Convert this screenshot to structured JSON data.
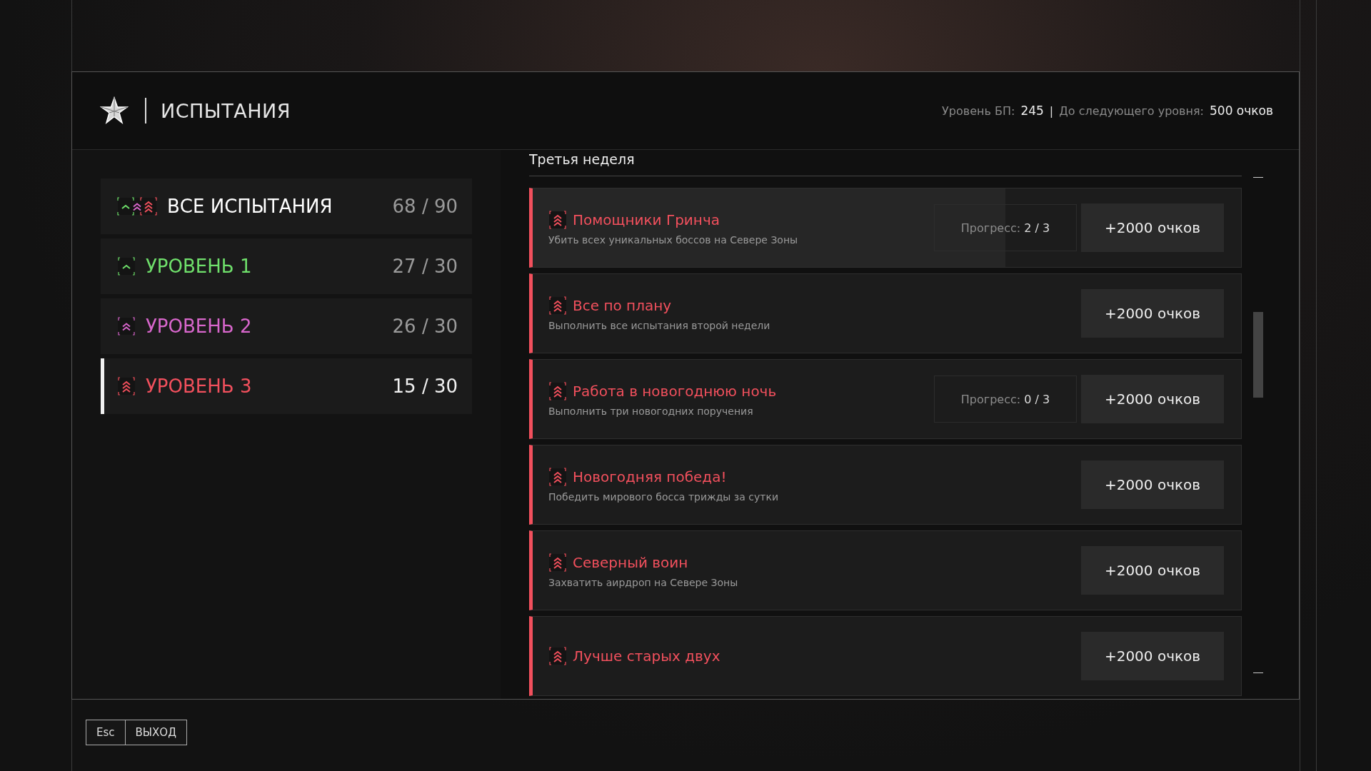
{
  "header": {
    "title": "ИСПЫТАНИЯ",
    "bp_label": "Уровень БП:",
    "bp_value": "245",
    "separator": "|",
    "next_label": "До следующего уровня:",
    "next_value": "500 очков"
  },
  "sidebar": {
    "items": [
      {
        "kind": "all",
        "label": "ВСЕ ИСПЫТАНИЯ",
        "count": "68 / 90",
        "color": "#ffffff",
        "selected": false
      },
      {
        "kind": "tier1",
        "label": "УРОВЕНЬ 1",
        "count": "27 / 30",
        "color": "#6fe06b",
        "selected": false
      },
      {
        "kind": "tier2",
        "label": "УРОВЕНЬ 2",
        "count": "26 / 30",
        "color": "#d866cc",
        "selected": false
      },
      {
        "kind": "tier3",
        "label": "УРОВЕНЬ 3",
        "count": "15 / 30",
        "color": "#f2505d",
        "selected": true
      }
    ]
  },
  "section_title": "Третья неделя",
  "challenges": [
    {
      "kind": "tier3",
      "title": "Помощники Гринча",
      "description": "Убить всех уникальных боссов на Севере Зоны",
      "progress_label": "Прогресс:",
      "progress_value": "2 / 3",
      "level": 0.667,
      "reward": "+2000 очков"
    },
    {
      "kind": "tier3",
      "title": "Все по плану",
      "description": "Выполнить все испытания второй недели",
      "reward": "+2000 очков"
    },
    {
      "kind": "tier3",
      "title": "Работа в новогоднюю ночь",
      "description": "Выполнить три новогодних поручения",
      "progress_label": "Прогресс:",
      "progress_value": "0 / 3",
      "reward": "+2000 очков"
    },
    {
      "kind": "tier3",
      "title": "Новогодняя победа!",
      "description": "Победить мирового босса трижды за сутки",
      "reward": "+2000 очков"
    },
    {
      "kind": "tier3",
      "title": "Северный воин",
      "description": "Захватить аирдроп на Севере Зоны",
      "reward": "+2000 очков"
    },
    {
      "kind": "tier3",
      "title": "Лучше старых двух",
      "reward": "+2000 очков"
    }
  ],
  "footer": {
    "key": "Esc",
    "label": "ВЫХОД"
  }
}
